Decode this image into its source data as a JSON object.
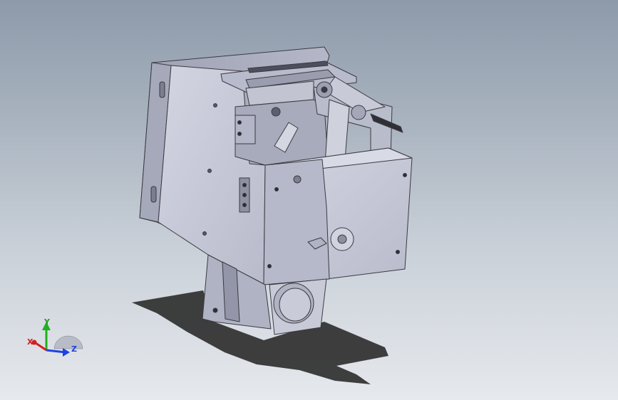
{
  "viewport": {
    "background_top": "#8d9aaa",
    "background_bottom": "#e6e9ed",
    "model_fill": "#c6c8d6",
    "model_edge": "#3a3a42",
    "shadow": "#2a2a2a"
  },
  "triad": {
    "x_label": "X",
    "y_label": "Y",
    "z_label": "Z",
    "x_color": "#d42020",
    "y_color": "#20b020",
    "z_color": "#2040e0"
  }
}
